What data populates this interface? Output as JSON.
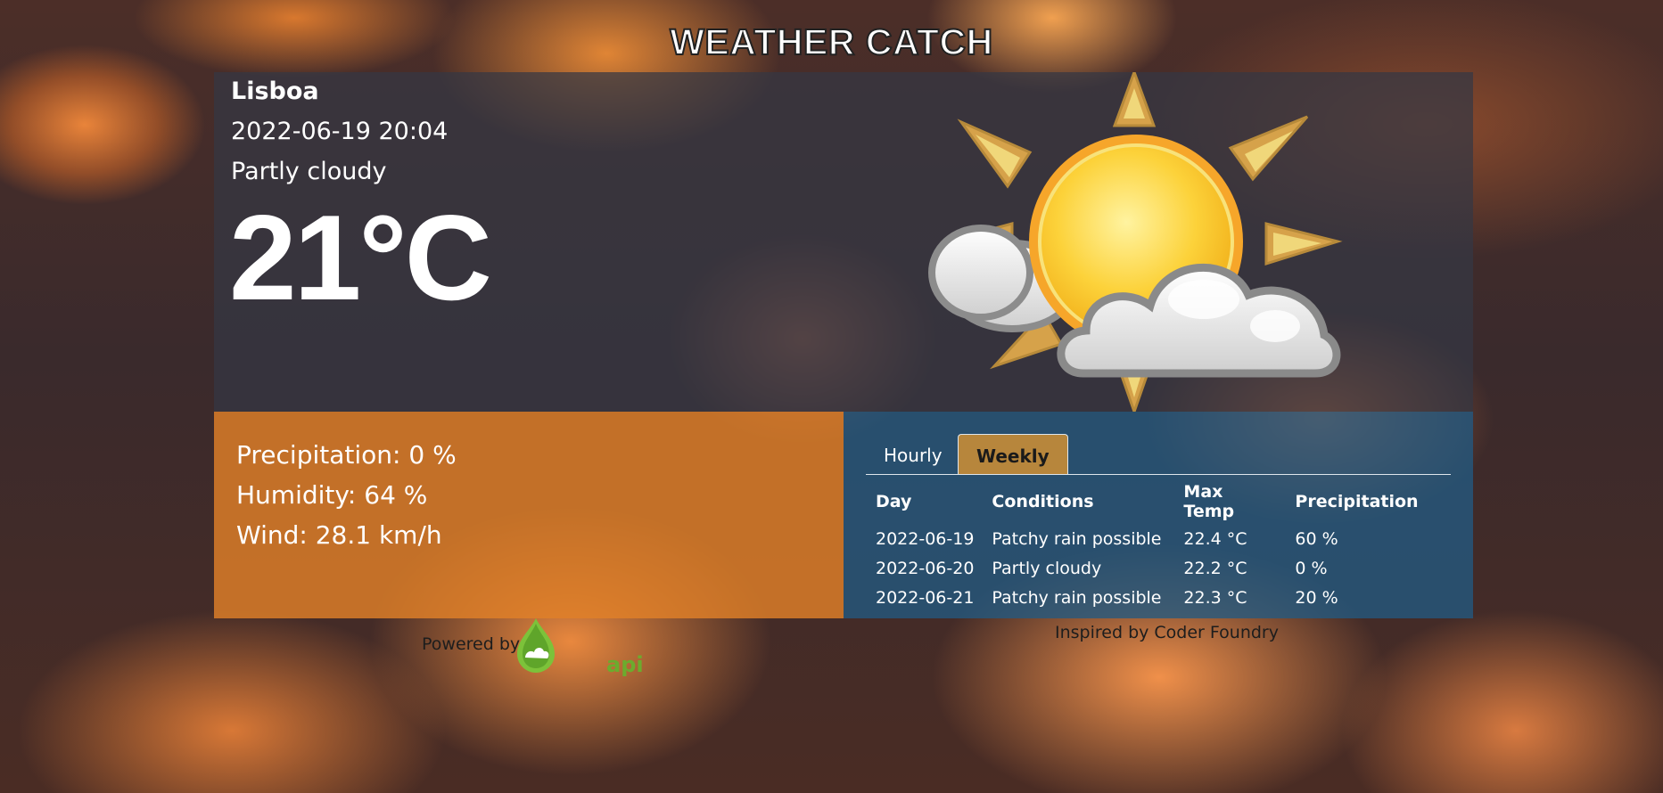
{
  "app": {
    "title": "WEATHER CATCH"
  },
  "current": {
    "city": "Lisboa",
    "datetime": "2022-06-19 20:04",
    "condition": "Partly cloudy",
    "temperature": "21°C",
    "icon": "partly-cloudy-sun-icon"
  },
  "stats": {
    "precipitation": "Precipitation: 0 %",
    "humidity": "Humidity: 64 %",
    "wind": "Wind: 28.1 km/h"
  },
  "forecast": {
    "tabs": [
      {
        "label": "Hourly",
        "active": false
      },
      {
        "label": "Weekly",
        "active": true
      }
    ],
    "headers": [
      "Day",
      "Conditions",
      "Max Temp",
      "Precipitation"
    ],
    "rows": [
      [
        "2022-06-19",
        "Patchy rain possible",
        "22.4 °C",
        "60 %"
      ],
      [
        "2022-06-20",
        "Partly cloudy",
        "22.2 °C",
        "0 %"
      ],
      [
        "2022-06-21",
        "Patchy rain possible",
        "22.3 °C",
        "20 %"
      ]
    ]
  },
  "footer": {
    "powered_by": "Powered by",
    "api_logo_text": "api",
    "inspired_by": "Inspired by Coder Foundry"
  },
  "colors": {
    "stats_panel": "#e18028",
    "forecast_panel": "#225a82",
    "active_tab": "#b7863c",
    "api_green": "#6cab2e"
  }
}
